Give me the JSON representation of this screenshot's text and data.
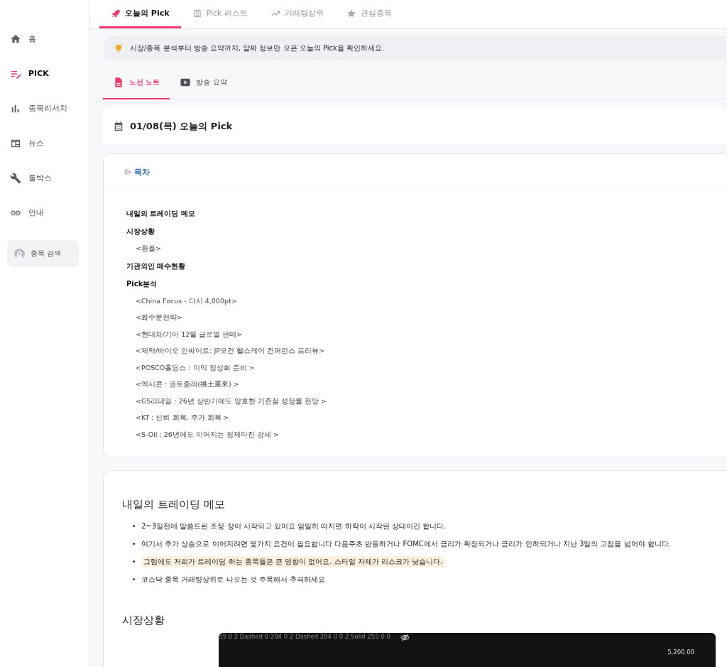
{
  "sidebar": {
    "items": [
      {
        "label": "홈",
        "kind": "home",
        "selected": false
      },
      {
        "label": "PICK",
        "kind": "pick",
        "selected": true
      },
      {
        "label": "종목리서치",
        "kind": "chart",
        "selected": false
      },
      {
        "label": "뉴스",
        "kind": "news",
        "selected": false
      },
      {
        "label": "툴박스",
        "kind": "wrench",
        "selected": false
      },
      {
        "label": "안내",
        "kind": "link",
        "selected": false
      }
    ],
    "search_button": "종목 검색"
  },
  "tabs": [
    {
      "label": "오늘의 Pick",
      "kind": "rocket",
      "selected": true
    },
    {
      "label": "Pick 리스트",
      "kind": "list",
      "selected": false
    },
    {
      "label": "거래량상위",
      "kind": "trend",
      "selected": false
    },
    {
      "label": "관심종목",
      "kind": "star",
      "selected": false
    }
  ],
  "notice": "시장/종목 분석부터 방송 요약까지, 알짜 정보만 모은 오늘의 Pick을 확인하세요.",
  "subtabs": [
    {
      "label": "노선 노트",
      "kind": "doc",
      "selected": true
    },
    {
      "label": "방송 요약",
      "kind": "video",
      "selected": false
    }
  ],
  "date_title": "01/08(목) 오늘의 Pick",
  "toc": {
    "title": "목차",
    "items": [
      {
        "label": "내일의 트레이딩 메모"
      },
      {
        "label": "시장상황",
        "children": [
          {
            "label": "<환율>"
          }
        ]
      },
      {
        "label": "기관외인 매수현황"
      },
      {
        "label": "Pick분석",
        "children": [
          {
            "label": "<China Focus - 다시 4,000pt>"
          },
          {
            "label": "<화수분전략>"
          },
          {
            "label": "<현대차/기아 12월 글로벌 판매>"
          },
          {
            "label": "<제약/바이오 인싸이트: JP모건 헬스케어 컨퍼런스 프리뷰>"
          },
          {
            "label": "<POSCO홀딩스 : 이익 정상화 준비 >"
          },
          {
            "label": "<엑시콘 : 권토중래(捲土重來) >"
          },
          {
            "label": "<GS리테일 : 26년 상반기에도 양호한 기존점 성장률 전망 >"
          },
          {
            "label": "<KT : 신뢰 회복, 주가 회복 >"
          },
          {
            "label": "<S-Oil : 26년에도 이어지는 정제마진 강세 >"
          }
        ]
      }
    ]
  },
  "memo": {
    "heading": "내일의 트레이딩 메모",
    "bullets": [
      {
        "text": "2~3일전에 말씀드린 조정 장이 시작되고 있어요 엄밀히 따지면 하락이 시작된 상태이긴 합니다.",
        "highlighted": false
      },
      {
        "text": "여기서 추가 상승으로 이어지려면 몇가지 요건이 필요합니다 다음주초 반등하거나 FOMC에서 금리가 확정되거나 금리가 인하되거나 지난 3일의 고점을 넘어야 합니다.",
        "highlighted": false
      },
      {
        "text": "그럼에도 저희가 트레이딩 하는 종목들은 큰 영향이 없어요. 스타일 자체가 리스크가 낮습니다.",
        "highlighted": true
      },
      {
        "text": "코스닥 종목 거래량상위로 나오는 것 주목해서 추격하세요",
        "highlighted": false
      }
    ]
  },
  "market": {
    "heading": "시장상황",
    "chart_legend": "55 0 2 Dashed 0 204 0 2 Dashed 204 0 0 2 Solid 255 0 0",
    "price_label": "5,200.00"
  }
}
